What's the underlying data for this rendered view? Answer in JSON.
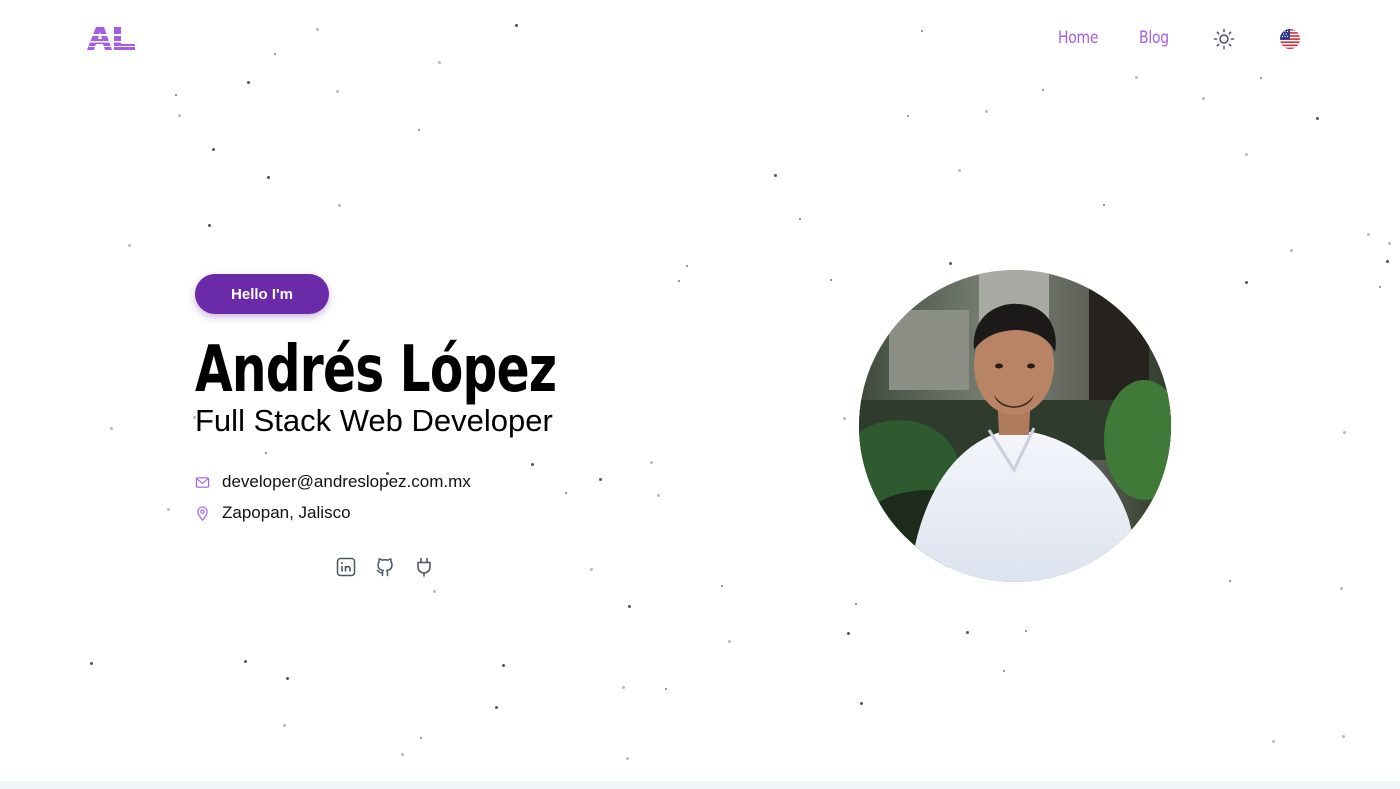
{
  "header": {
    "logo_text": "AL",
    "nav": [
      {
        "label": "Home"
      },
      {
        "label": "Blog"
      }
    ],
    "theme_icon": "sun-icon",
    "language_icon": "us-flag-icon"
  },
  "hero": {
    "badge": "Hello I'm",
    "name": "Andrés López",
    "role": "Full Stack Web Developer",
    "email": "developer@andreslopez.com.mx",
    "location": "Zapopan, Jalisco",
    "socials": [
      {
        "icon": "linkedin-icon"
      },
      {
        "icon": "github-icon"
      },
      {
        "icon": "plug-icon"
      }
    ],
    "avatar_icon": "profile-photo"
  },
  "colors": {
    "accent": "#a45ee6",
    "badge": "#6b2aa8",
    "text": "#000000",
    "icon_gray": "#4b5563"
  }
}
